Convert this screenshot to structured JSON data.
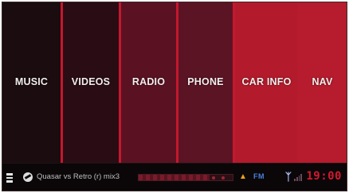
{
  "tiles": [
    {
      "label": "MUSIC",
      "color": "#1a0c0f"
    },
    {
      "label": "VIDEOS",
      "color": "#2a0c14"
    },
    {
      "label": "RADIO",
      "color": "#5a1222"
    },
    {
      "label": "PHONE",
      "color": "#5b1424"
    },
    {
      "label": "CAR INFO",
      "color": "#b31b2c"
    },
    {
      "label": "NAV",
      "color": "#b61c2d"
    }
  ],
  "status": {
    "track": "Quasar vs Retro (r) mix3",
    "progress": 0.75,
    "traffic_icon": "traffic-icon",
    "band": "FM",
    "bluetooth_icon": "bluetooth-icon",
    "clock": "19:00"
  },
  "colors": {
    "accent_red": "#d3182e",
    "separator": "#c4182e",
    "background": "#0a0507"
  }
}
